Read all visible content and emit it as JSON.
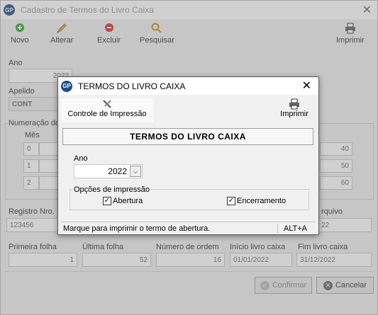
{
  "window": {
    "title": "Cadastro de Termos do Livro Caixa",
    "close": "✕"
  },
  "toolbar": {
    "novo": "Novo",
    "alterar": "Alterar",
    "excluir": "Excluir",
    "pesquisar": "Pesquisar",
    "imprimir": "Imprimir"
  },
  "form": {
    "ano_label": "Ano",
    "ano_value": "2022",
    "apelido_label": "Apelido",
    "apelido_value": "CONT",
    "numeracao_label": "Numeração do",
    "mes_label": "Mês",
    "rows": [
      {
        "idx": "0",
        "val": "40"
      },
      {
        "idx": "1",
        "val": "50"
      },
      {
        "idx": "2",
        "val": "60"
      }
    ],
    "registro_label": "Registro Nro.",
    "registro_value": "123456",
    "arquivo_label": "rquivo",
    "arquivo_value": "22",
    "primeira_label": "Primeira folha",
    "primeira_value": "1",
    "ultima_label": "Última folha",
    "ultima_value": "52",
    "ordem_label": "Número de ordem",
    "ordem_value": "16",
    "inicio_label": "Início livro caixa",
    "inicio_value": "01/01/2022",
    "fim_label": "Fim livro caixa",
    "fim_value": "31/12/2022",
    "confirmar": "Confirmar",
    "cancelar": "Cancelar"
  },
  "dialog": {
    "title": "TERMOS DO LIVRO CAIXA",
    "close": "✕",
    "tab": "Controle de Impressão",
    "imprimir": "Imprimir",
    "banner": "TERMOS DO LIVRO CAIXA",
    "ano_label": "Ano",
    "ano_value": "2022",
    "opcoes_label": "Opções de impressão",
    "abertura": "Abertura",
    "encerramento": "Encerramento",
    "status": "Marque para imprimir o termo de abertura.",
    "shortcut": "ALT+A"
  },
  "app_icon": "GP",
  "icons": {
    "novo": "plus-icon",
    "alterar": "pencil-icon",
    "excluir": "minus-icon",
    "pesquisar": "search-icon",
    "imprimir": "printer-icon"
  },
  "colors": {
    "novo": "#2ea82e",
    "excluir": "#d9302c",
    "dialog_border": "#5a5a5a"
  }
}
